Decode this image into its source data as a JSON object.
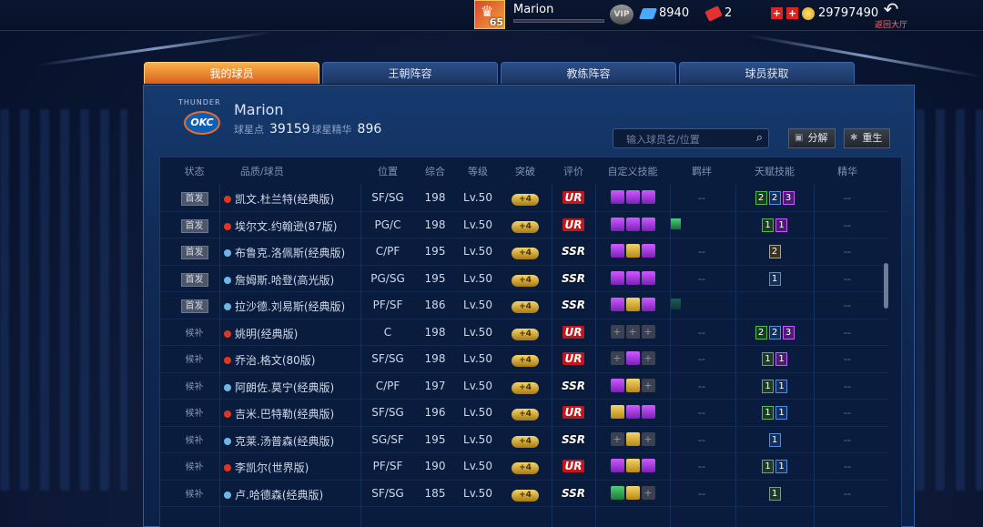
{
  "topbar": {
    "player_level": "65",
    "player_name": "Marion",
    "vip_label": "VIP",
    "diamonds": "8940",
    "tickets": "2",
    "coins": "29797490",
    "back_label": "返回大厅"
  },
  "tabs": [
    {
      "label": "我的球员",
      "active": true
    },
    {
      "label": "王朝阵容",
      "active": false
    },
    {
      "label": "教练阵容",
      "active": false
    },
    {
      "label": "球员获取",
      "active": false
    }
  ],
  "team": {
    "logo_text": "OKC",
    "logo_arc": "THUNDER",
    "name": "Marion",
    "star_points_label": "球星点",
    "star_points": "39159",
    "essence_label": "球星精华",
    "essence": "896"
  },
  "search": {
    "placeholder": "输入球员名/位置"
  },
  "buttons": {
    "decompose": "分解",
    "rebirth": "重生"
  },
  "columns": [
    "状态",
    "品质/球员",
    "位置",
    "综合",
    "等级",
    "突破",
    "评价",
    "自定义技能",
    "羁绊",
    "天赋技能",
    "精华"
  ],
  "rows": [
    {
      "status": "首发",
      "quality": "ur",
      "name": "凯文.杜兰特(经典版)",
      "pos": "SF/SG",
      "ovr": "198",
      "lvl": "Lv.50",
      "brk": "+4",
      "rate": "UR",
      "skills": [
        "p",
        "p",
        "p"
      ],
      "bond": "--",
      "talents": [
        {
          "t": "g",
          "v": "2"
        },
        {
          "t": "b",
          "v": "2"
        },
        {
          "t": "p",
          "v": "3"
        }
      ],
      "essence": "--"
    },
    {
      "status": "首发",
      "quality": "ur",
      "name": "埃尔文.约翰逊(87版)",
      "pos": "PG/C",
      "ovr": "198",
      "lvl": "Lv.50",
      "brk": "+4",
      "rate": "UR",
      "skills": [
        "p",
        "p",
        "p"
      ],
      "bond": "gem",
      "talents": [
        {
          "t": "g",
          "v": "1"
        },
        {
          "t": "p",
          "v": "1"
        }
      ],
      "essence": "--"
    },
    {
      "status": "首发",
      "quality": "ssr",
      "name": "布鲁克.洛佩斯(经典版)",
      "pos": "C/PF",
      "ovr": "195",
      "lvl": "Lv.50",
      "brk": "+4",
      "rate": "SSR",
      "skills": [
        "p",
        "g",
        "p"
      ],
      "bond": "--",
      "talents": [
        {
          "t": "y",
          "v": "2"
        }
      ],
      "essence": "--"
    },
    {
      "status": "首发",
      "quality": "ssr",
      "name": "詹姆斯.哈登(高光版)",
      "pos": "PG/SG",
      "ovr": "195",
      "lvl": "Lv.50",
      "brk": "+4",
      "rate": "SSR",
      "skills": [
        "p",
        "p",
        "p"
      ],
      "bond": "--",
      "talents": [
        {
          "t": "b",
          "v": "1"
        }
      ],
      "essence": "--"
    },
    {
      "status": "首发",
      "quality": "ssr",
      "name": "拉沙德.刘易斯(经典版)",
      "pos": "PF/SF",
      "ovr": "186",
      "lvl": "Lv.50",
      "brk": "+4",
      "rate": "SSR",
      "skills": [
        "p",
        "g",
        "p"
      ],
      "bond": "dim",
      "talents": [],
      "essence": "--"
    },
    {
      "status": "候补",
      "quality": "ur",
      "name": "姚明(经典版)",
      "pos": "C",
      "ovr": "198",
      "lvl": "Lv.50",
      "brk": "+4",
      "rate": "UR",
      "skills": [
        "e",
        "e",
        "e"
      ],
      "bond": "--",
      "talents": [
        {
          "t": "g",
          "v": "2"
        },
        {
          "t": "b",
          "v": "2"
        },
        {
          "t": "p",
          "v": "3"
        }
      ],
      "essence": "--"
    },
    {
      "status": "候补",
      "quality": "ur",
      "name": "乔治.格文(80版)",
      "pos": "SF/SG",
      "ovr": "198",
      "lvl": "Lv.50",
      "brk": "+4",
      "rate": "UR",
      "skills": [
        "e",
        "p",
        "e"
      ],
      "bond": "--",
      "talents": [
        {
          "t": "g",
          "v": "1"
        },
        {
          "t": "p",
          "v": "1"
        }
      ],
      "essence": "--"
    },
    {
      "status": "候补",
      "quality": "ssr",
      "name": "阿朗佐.莫宁(经典版)",
      "pos": "C/PF",
      "ovr": "197",
      "lvl": "Lv.50",
      "brk": "+4",
      "rate": "SSR",
      "skills": [
        "p",
        "g",
        "e"
      ],
      "bond": "--",
      "talents": [
        {
          "t": "g",
          "v": "1"
        },
        {
          "t": "b",
          "v": "1"
        }
      ],
      "essence": "--"
    },
    {
      "status": "候补",
      "quality": "ur",
      "name": "吉米.巴特勒(经典版)",
      "pos": "SF/SG",
      "ovr": "196",
      "lvl": "Lv.50",
      "brk": "+4",
      "rate": "UR",
      "skills": [
        "g",
        "p",
        "p"
      ],
      "bond": "--",
      "talents": [
        {
          "t": "g",
          "v": "1"
        },
        {
          "t": "b",
          "v": "1"
        }
      ],
      "essence": "--"
    },
    {
      "status": "候补",
      "quality": "ssr",
      "name": "克莱.汤普森(经典版)",
      "pos": "SG/SF",
      "ovr": "195",
      "lvl": "Lv.50",
      "brk": "+4",
      "rate": "SSR",
      "skills": [
        "e",
        "g",
        "e"
      ],
      "bond": "--",
      "talents": [
        {
          "t": "b",
          "v": "1"
        }
      ],
      "essence": "--"
    },
    {
      "status": "候补",
      "quality": "ur",
      "name": "李凯尔(世界版)",
      "pos": "PF/SF",
      "ovr": "190",
      "lvl": "Lv.50",
      "brk": "+4",
      "rate": "UR",
      "skills": [
        "p",
        "g",
        "p"
      ],
      "bond": "--",
      "talents": [
        {
          "t": "g",
          "v": "1"
        },
        {
          "t": "b",
          "v": "1"
        }
      ],
      "essence": "--"
    },
    {
      "status": "候补",
      "quality": "ssr",
      "name": "卢.哈德森(经典版)",
      "pos": "SF/SG",
      "ovr": "185",
      "lvl": "Lv.50",
      "brk": "+4",
      "rate": "SSR",
      "skills": [
        "gr",
        "g",
        "e"
      ],
      "bond": "--",
      "talents": [
        {
          "t": "g",
          "v": "1"
        }
      ],
      "essence": "--"
    }
  ]
}
